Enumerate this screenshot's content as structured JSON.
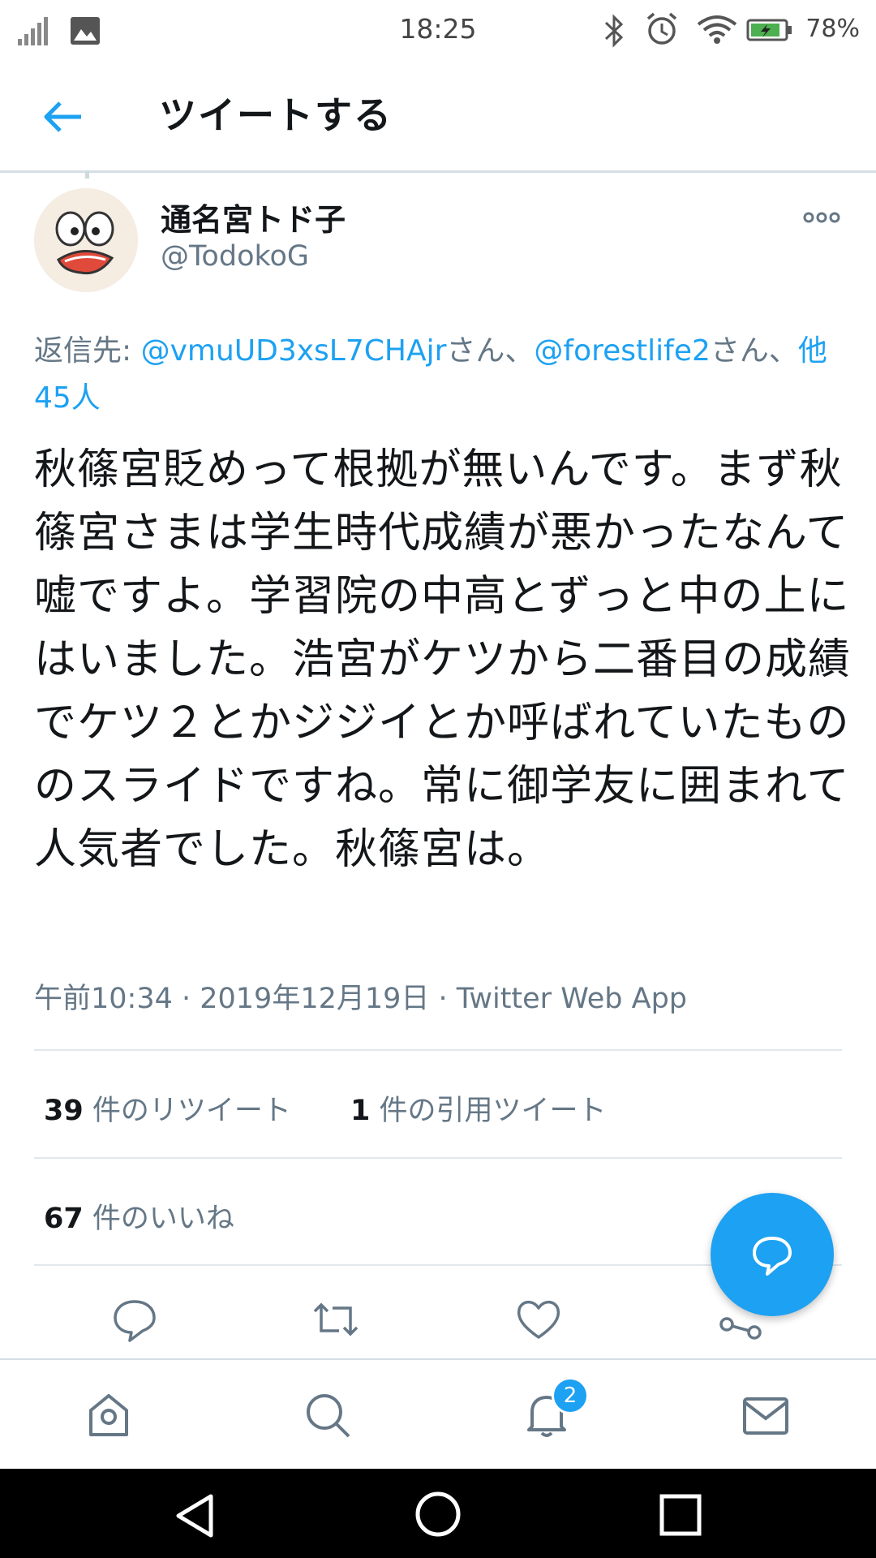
{
  "status_bar": {
    "time": "18:25",
    "battery_percent": "78%",
    "icons": [
      "signal-icon",
      "image-notification-icon",
      "bluetooth-icon",
      "alarm-icon",
      "wifi-icon",
      "battery-icon"
    ]
  },
  "header": {
    "title": "ツイートする",
    "back_icon": "back-arrow-icon"
  },
  "tweet": {
    "author_name": "通名宮トド子",
    "author_handle": "@TodokoG",
    "reply_prefix": "返信先: ",
    "reply_user1": "@vmuUD3xsL7CHAjr",
    "reply_sep1": "さん、",
    "reply_user2": "@forestlife2",
    "reply_sep2": "さん、",
    "reply_others": "他45人",
    "text": "秋篠宮貶めって根拠が無いんです。まず秋篠宮さまは学生時代成績が悪かったなんて嘘ですよ。学習院の中高とずっと中の上にはいました。浩宮がケツから二番目の成績でケツ２とかジジイとか呼ばれていたもののスライドですね。常に御学友に囲まれて人気者でした。秋篠宮は。",
    "meta": "午前10:34 · 2019年12月19日 · Twitter Web App"
  },
  "stats": {
    "retweets_count": "39",
    "retweets_label": " 件のリツイート",
    "quotes_count": "1",
    "quotes_label": " 件の引用ツイート",
    "likes_count": "67",
    "likes_label": " 件のいいね"
  },
  "actions": [
    "reply-icon",
    "retweet-icon",
    "like-icon",
    "share-icon"
  ],
  "tabbar": {
    "tabs": [
      "home-icon",
      "search-icon",
      "notifications-icon",
      "messages-icon"
    ],
    "notification_badge": "2"
  },
  "colors": {
    "accent": "#1da1f2",
    "secondary_text": "#657786",
    "primary_text": "#14171a"
  }
}
